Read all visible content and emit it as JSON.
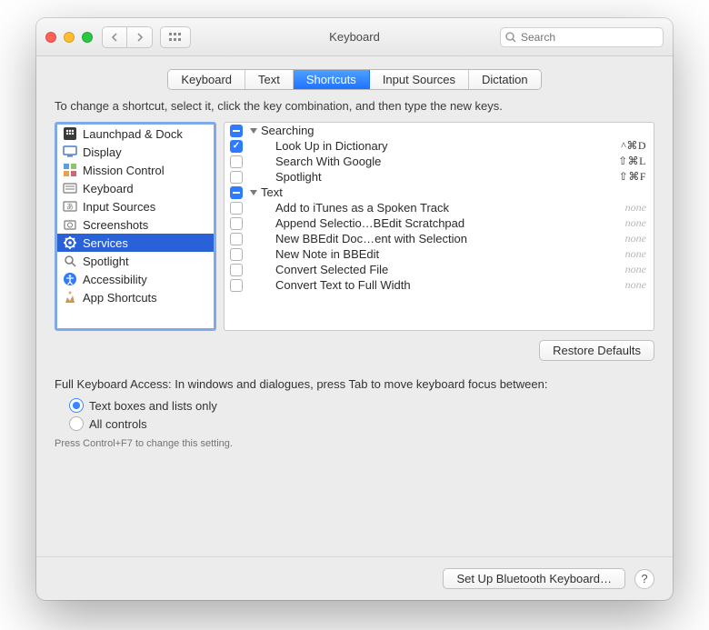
{
  "window": {
    "title": "Keyboard"
  },
  "search": {
    "placeholder": "Search"
  },
  "tabs": [
    "Keyboard",
    "Text",
    "Shortcuts",
    "Input Sources",
    "Dictation"
  ],
  "active_tab_index": 2,
  "instruction": "To change a shortcut, select it, click the key combination, and then type the new keys.",
  "categories": [
    {
      "icon": "launchpad",
      "label": "Launchpad & Dock"
    },
    {
      "icon": "display",
      "label": "Display"
    },
    {
      "icon": "mission",
      "label": "Mission Control"
    },
    {
      "icon": "keyboard",
      "label": "Keyboard"
    },
    {
      "icon": "input",
      "label": "Input Sources"
    },
    {
      "icon": "screenshot",
      "label": "Screenshots"
    },
    {
      "icon": "services",
      "label": "Services"
    },
    {
      "icon": "spotlight",
      "label": "Spotlight"
    },
    {
      "icon": "accessibility",
      "label": "Accessibility"
    },
    {
      "icon": "app",
      "label": "App Shortcuts"
    }
  ],
  "selected_category_index": 6,
  "shortcut_groups": [
    {
      "label": "Searching",
      "state": "mixed",
      "items": [
        {
          "label": "Look Up in Dictionary",
          "shortcut": "^⌘D",
          "checked": true
        },
        {
          "label": "Search With Google",
          "shortcut": "⇧⌘L",
          "checked": false
        },
        {
          "label": "Spotlight",
          "shortcut": "⇧⌘F",
          "checked": false
        }
      ]
    },
    {
      "label": "Text",
      "state": "mixed",
      "items": [
        {
          "label": "Add to iTunes as a Spoken Track",
          "shortcut": "none",
          "checked": false
        },
        {
          "label": "Append Selectio…BEdit Scratchpad",
          "shortcut": "none",
          "checked": false
        },
        {
          "label": "New BBEdit Doc…ent with Selection",
          "shortcut": "none",
          "checked": false
        },
        {
          "label": "New Note in BBEdit",
          "shortcut": "none",
          "checked": false
        },
        {
          "label": "Convert Selected File",
          "shortcut": "none",
          "checked": false
        },
        {
          "label": "Convert Text to Full Width",
          "shortcut": "none",
          "checked": false
        }
      ]
    }
  ],
  "restore_label": "Restore Defaults",
  "fka": {
    "heading": "Full Keyboard Access: In windows and dialogues, press Tab to move keyboard focus between:",
    "options": [
      "Text boxes and lists only",
      "All controls"
    ],
    "selected": 0,
    "hint": "Press Control+F7 to change this setting."
  },
  "footer": {
    "bluetooth": "Set Up Bluetooth Keyboard…"
  }
}
